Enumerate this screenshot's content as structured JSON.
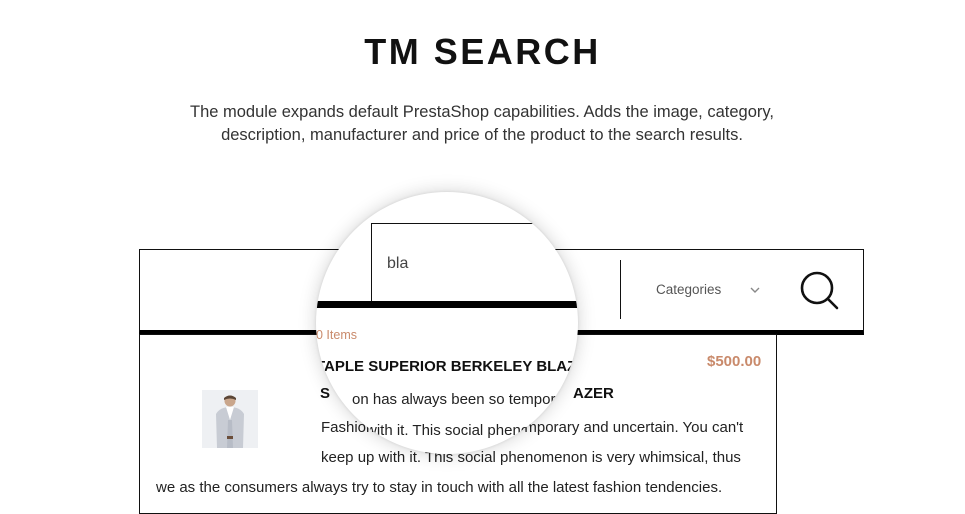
{
  "heading": {
    "title": "TM SEARCH",
    "description_line1": "The module expands default PrestaShop capabilities. Adds the image, category,",
    "description_line2": "description, manufacturer and price of the product to the search results."
  },
  "search": {
    "query": "bla",
    "categories_label": "Categories",
    "items_count": "0 Items"
  },
  "result": {
    "price": "$500.00",
    "name_magnified": "TAPLE SUPERIOR BERKELEY BLAZE",
    "name_underlay_prefix": "S",
    "name_underlay_suffix": "AZER",
    "desc_line1_magnified": "on has always been so temporary",
    "desc_line2_prefix": "Fashion",
    "desc_line2_magnified": "with it.  This social pheno",
    "desc_line2_suffix": "mporary and uncertain. You can't",
    "desc_line3": "keep up with it.  This social phenomenon is very whimsical, thus",
    "desc_line4": "we as the consumers always try to stay in touch with all the latest fashion tendencies."
  },
  "icons": {
    "search": "search-icon",
    "dropdown": "chevron-down-icon",
    "product": "product-image"
  },
  "colors": {
    "accent": "#c98a6b",
    "text": "#222222",
    "border": "#111111"
  }
}
